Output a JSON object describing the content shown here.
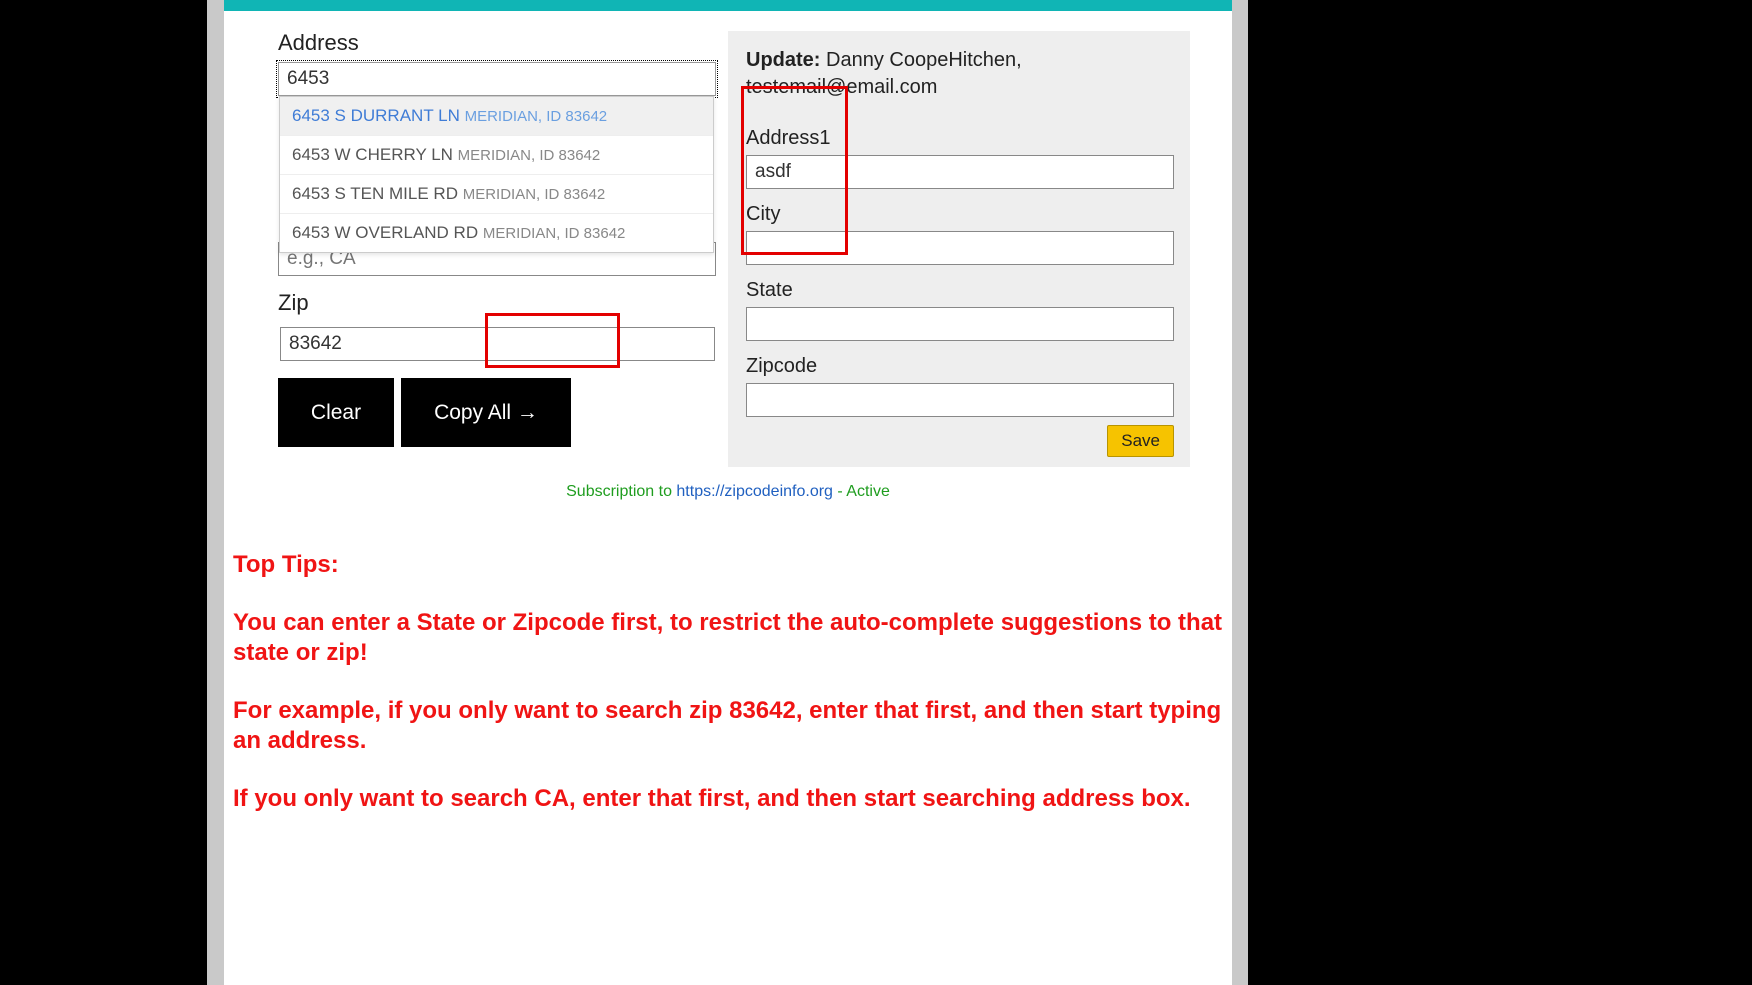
{
  "left": {
    "address_label": "Address",
    "address_value": "6453",
    "suggestions": [
      {
        "street": "6453 S DURRANT LN",
        "loc": "MERIDIAN, ID 83642",
        "hl": true
      },
      {
        "street": "6453 W CHERRY LN",
        "loc": "MERIDIAN, ID 83642",
        "hl": false
      },
      {
        "street": "6453 S TEN MILE RD",
        "loc": "MERIDIAN, ID 83642",
        "hl": false
      },
      {
        "street": "6453 W OVERLAND RD",
        "loc": "MERIDIAN, ID 83642",
        "hl": false
      }
    ],
    "state_placeholder": "e.g., CA",
    "zip_label": "Zip",
    "zip_value": "83642",
    "clear_label": "Clear",
    "copy_label": "Copy All →"
  },
  "right": {
    "update_prefix": "Update:",
    "update_name": "Danny CoopeHitchen,",
    "update_email": "testemail@email.com",
    "address1_label": "Address1",
    "address1_value": "asdf",
    "city_label": "City",
    "city_value": "",
    "state_label": "State",
    "state_value": "",
    "zipcode_label": "Zipcode",
    "zipcode_value": "",
    "save_label": "Save"
  },
  "sub": {
    "s1": "Subscription to ",
    "s2": "https://zipcodeinfo.org",
    "s3": " - Active"
  },
  "tips": {
    "title": "Top Tips:",
    "p1": "You can enter a State or Zipcode first, to restrict the auto-complete suggestions to that state or zip!",
    "p2": "For example, if you only want to search zip 83642, enter that first, and then start typing an address.",
    "p3": "If you only want to search CA, enter that first, and then start searching address box."
  }
}
